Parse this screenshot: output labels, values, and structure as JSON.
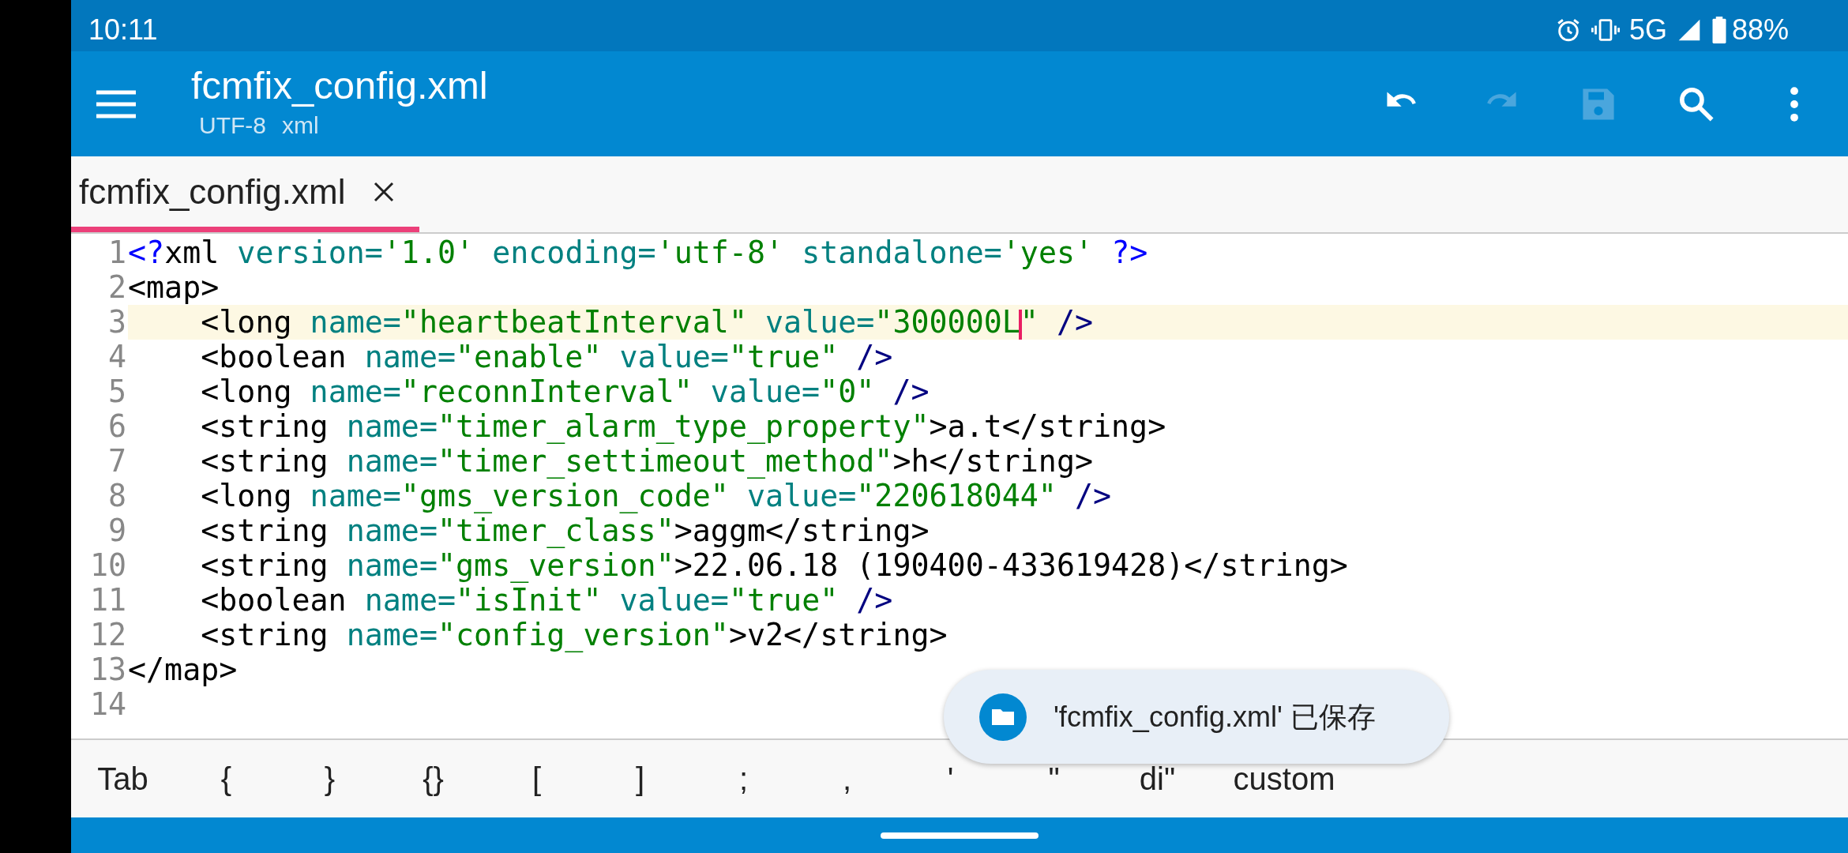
{
  "status_bar": {
    "time": "10:11",
    "network": "5G",
    "battery": "88%"
  },
  "app_bar": {
    "title": "fcmfix_config.xml",
    "encoding": "UTF-8",
    "language": "xml",
    "actions": [
      {
        "kind": "undo",
        "disabled": false
      },
      {
        "kind": "redo",
        "disabled": true
      },
      {
        "kind": "save",
        "disabled": true
      },
      {
        "kind": "search",
        "disabled": false
      },
      {
        "kind": "more",
        "disabled": false
      }
    ]
  },
  "tabs": [
    {
      "label": "fcmfix_config.xml",
      "selected": true
    }
  ],
  "editor": {
    "lines": [
      {
        "number": "1",
        "current": false,
        "tokens": [
          {
            "kind": "decl",
            "text": "<?"
          },
          {
            "kind": "text",
            "text": "xml"
          },
          {
            "kind": "attr",
            "text": " version="
          },
          {
            "kind": "string",
            "text": "'1.0'"
          },
          {
            "kind": "attr",
            "text": " encoding="
          },
          {
            "kind": "string",
            "text": "'utf-8'"
          },
          {
            "kind": "attr",
            "text": " standalone="
          },
          {
            "kind": "string",
            "text": "'yes'"
          },
          {
            "kind": "decl",
            "text": " ?>"
          }
        ]
      },
      {
        "number": "2",
        "current": false,
        "tokens": [
          {
            "kind": "text",
            "text": "<map>"
          }
        ]
      },
      {
        "number": "3",
        "current": true,
        "tokens": [
          {
            "kind": "text",
            "text": "    <long"
          },
          {
            "kind": "attr",
            "text": " name="
          },
          {
            "kind": "string",
            "text": "\"heartbeatInterval\""
          },
          {
            "kind": "attr",
            "text": " value="
          },
          {
            "kind": "string",
            "text": "\"300000L"
          },
          {
            "kind": "cursor"
          },
          {
            "kind": "string",
            "text": "\""
          },
          {
            "kind": "close",
            "text": " />"
          }
        ]
      },
      {
        "number": "4",
        "current": false,
        "tokens": [
          {
            "kind": "text",
            "text": "    <boolean"
          },
          {
            "kind": "attr",
            "text": " name="
          },
          {
            "kind": "string",
            "text": "\"enable\""
          },
          {
            "kind": "attr",
            "text": " value="
          },
          {
            "kind": "string",
            "text": "\"true\""
          },
          {
            "kind": "close",
            "text": " />"
          }
        ]
      },
      {
        "number": "5",
        "current": false,
        "tokens": [
          {
            "kind": "text",
            "text": "    <long"
          },
          {
            "kind": "attr",
            "text": " name="
          },
          {
            "kind": "string",
            "text": "\"reconnInterval\""
          },
          {
            "kind": "attr",
            "text": " value="
          },
          {
            "kind": "string",
            "text": "\"0\""
          },
          {
            "kind": "close",
            "text": " />"
          }
        ]
      },
      {
        "number": "6",
        "current": false,
        "tokens": [
          {
            "kind": "text",
            "text": "    <string"
          },
          {
            "kind": "attr",
            "text": " name="
          },
          {
            "kind": "string",
            "text": "\"timer_alarm_type_property\""
          },
          {
            "kind": "text",
            "text": ">a.t</string>"
          }
        ]
      },
      {
        "number": "7",
        "current": false,
        "tokens": [
          {
            "kind": "text",
            "text": "    <string"
          },
          {
            "kind": "attr",
            "text": " name="
          },
          {
            "kind": "string",
            "text": "\"timer_settimeout_method\""
          },
          {
            "kind": "text",
            "text": ">h</string>"
          }
        ]
      },
      {
        "number": "8",
        "current": false,
        "tokens": [
          {
            "kind": "text",
            "text": "    <long"
          },
          {
            "kind": "attr",
            "text": " name="
          },
          {
            "kind": "string",
            "text": "\"gms_version_code\""
          },
          {
            "kind": "attr",
            "text": " value="
          },
          {
            "kind": "string",
            "text": "\"220618044\""
          },
          {
            "kind": "close",
            "text": " />"
          }
        ]
      },
      {
        "number": "9",
        "current": false,
        "tokens": [
          {
            "kind": "text",
            "text": "    <string"
          },
          {
            "kind": "attr",
            "text": " name="
          },
          {
            "kind": "string",
            "text": "\"timer_class\""
          },
          {
            "kind": "text",
            "text": ">aggm</string>"
          }
        ]
      },
      {
        "number": "10",
        "current": false,
        "tokens": [
          {
            "kind": "text",
            "text": "    <string"
          },
          {
            "kind": "attr",
            "text": " name="
          },
          {
            "kind": "string",
            "text": "\"gms_version\""
          },
          {
            "kind": "text",
            "text": ">22.06.18 (190400-433619428)</string>"
          }
        ]
      },
      {
        "number": "11",
        "current": false,
        "tokens": [
          {
            "kind": "text",
            "text": "    <boolean"
          },
          {
            "kind": "attr",
            "text": " name="
          },
          {
            "kind": "string",
            "text": "\"isInit\""
          },
          {
            "kind": "attr",
            "text": " value="
          },
          {
            "kind": "string",
            "text": "\"true\""
          },
          {
            "kind": "close",
            "text": " />"
          }
        ]
      },
      {
        "number": "12",
        "current": false,
        "tokens": [
          {
            "kind": "text",
            "text": "    <string"
          },
          {
            "kind": "attr",
            "text": " name="
          },
          {
            "kind": "string",
            "text": "\"config_version\""
          },
          {
            "kind": "text",
            "text": ">v2</string>"
          }
        ]
      },
      {
        "number": "13",
        "current": false,
        "tokens": [
          {
            "kind": "text",
            "text": "</map>"
          }
        ]
      },
      {
        "number": "14",
        "current": false
      }
    ]
  },
  "snackbar": {
    "message": "'fcmfix_config.xml' 已保存"
  },
  "symbol_keys": [
    "Tab",
    "{",
    "}",
    "{}",
    "[",
    "]",
    ";",
    ",",
    "'",
    "\"",
    "di\"",
    "custom"
  ]
}
